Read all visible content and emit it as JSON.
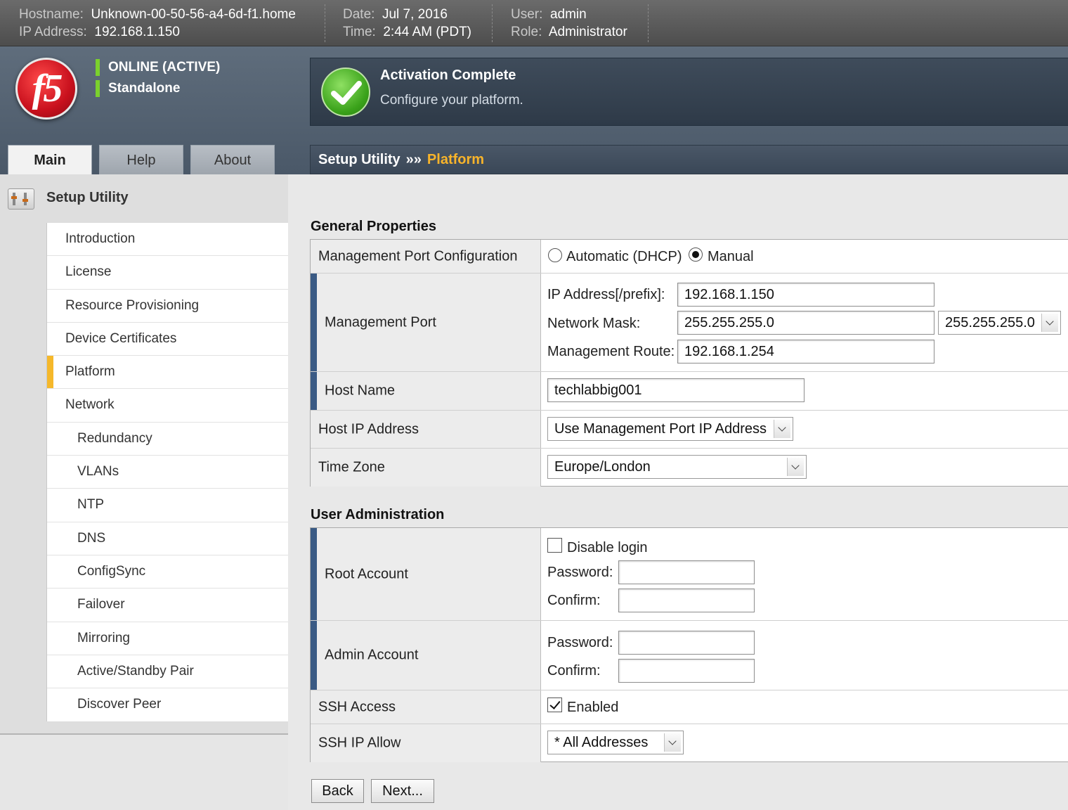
{
  "topbar": {
    "hostname_label": "Hostname:",
    "hostname": "Unknown-00-50-56-a4-6d-f1.home",
    "ip_label": "IP Address:",
    "ip": "192.168.1.150",
    "date_label": "Date:",
    "date": "Jul 7, 2016",
    "time_label": "Time:",
    "time": "2:44 AM (PDT)",
    "user_label": "User:",
    "user": "admin",
    "role_label": "Role:",
    "role": "Administrator"
  },
  "header": {
    "logo_text": "f5",
    "status": "ONLINE (ACTIVE)",
    "mode": "Standalone",
    "activation_title": "Activation Complete",
    "activation_sub": "Configure your platform."
  },
  "tabs": [
    {
      "label": "Main"
    },
    {
      "label": "Help"
    },
    {
      "label": "About"
    }
  ],
  "breadcrumb": {
    "root": "Setup Utility",
    "separator": "»»",
    "current": "Platform"
  },
  "sidebar": {
    "title": "Setup Utility",
    "items": [
      {
        "label": "Introduction"
      },
      {
        "label": "License"
      },
      {
        "label": "Resource Provisioning"
      },
      {
        "label": "Device Certificates"
      },
      {
        "label": "Platform"
      },
      {
        "label": "Network"
      },
      {
        "label": "Redundancy"
      },
      {
        "label": "VLANs"
      },
      {
        "label": "NTP"
      },
      {
        "label": "DNS"
      },
      {
        "label": "ConfigSync"
      },
      {
        "label": "Failover"
      },
      {
        "label": "Mirroring"
      },
      {
        "label": "Active/Standby Pair"
      },
      {
        "label": "Discover Peer"
      }
    ]
  },
  "general": {
    "title": "General Properties",
    "mgmt_config_label": "Management Port Configuration",
    "opt_dhcp": "Automatic (DHCP)",
    "opt_manual": "Manual",
    "mgmt_port_label": "Management Port",
    "ip_prefix_label": "IP Address[/prefix]:",
    "ip_prefix_value": "192.168.1.150",
    "netmask_label": "Network Mask:",
    "netmask_value": "255.255.255.0",
    "netmask_select": "255.255.255.0",
    "route_label": "Management Route:",
    "route_value": "192.168.1.254",
    "hostname_label": "Host Name",
    "hostname_value": "techlabbig001",
    "host_ip_label": "Host IP Address",
    "host_ip_value": "Use Management Port IP Address",
    "timezone_label": "Time Zone",
    "timezone_value": "Europe/London"
  },
  "users": {
    "title": "User Administration",
    "root_label": "Root Account",
    "disable_login": "Disable login",
    "password_label": "Password:",
    "confirm_label": "Confirm:",
    "admin_label": "Admin Account",
    "ssh_access_label": "SSH Access",
    "ssh_enabled": "Enabled",
    "ssh_allow_label": "SSH IP Allow",
    "ssh_allow_value": "* All Addresses"
  },
  "buttons": {
    "back": "Back",
    "next": "Next..."
  }
}
